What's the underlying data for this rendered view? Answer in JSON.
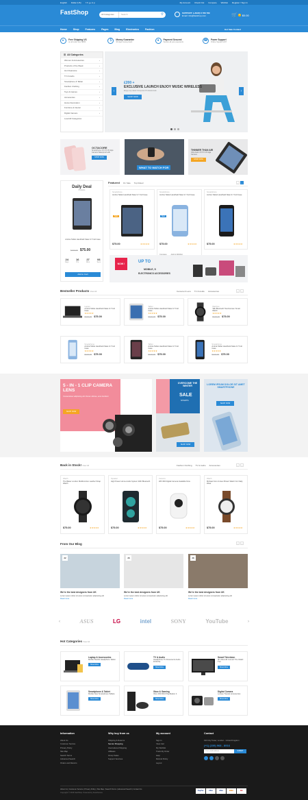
{
  "topbar": {
    "language": "English",
    "currency": "Dollar (US)",
    "links": [
      "My Account",
      "Check Out",
      "Compare",
      "Wishlist",
      "Register / Sign In"
    ]
  },
  "header": {
    "logo": "FastShop",
    "search_category": "All Categories",
    "search_placeholder": "Search",
    "support_title": "SUPPORT: (+8422) 6 789 789",
    "support_email": "Email: info@fastshop.com",
    "cart_count": "0",
    "cart_total": "$0.00"
  },
  "nav": {
    "items": [
      "Home",
      "Shop",
      "Features",
      "Pages",
      "Blog",
      "Electronics",
      "Fashion"
    ],
    "right": "Hot Sale  Contact"
  },
  "features": [
    {
      "title": "Free Shipping US",
      "sub": "on all order over $250"
    },
    {
      "title": "Money Guarantee",
      "sub": "30 days money back"
    },
    {
      "title": "Payment Secured",
      "sub": "Secure all your payments"
    },
    {
      "title": "Power Support",
      "sub": "Online Support 24/7"
    }
  ],
  "categories": {
    "heading": "All Categories",
    "items": [
      "Women & Accessories",
      "Products of the Week",
      "Hot Clearance",
      "TV & Audio",
      "Smartphone & Tablet",
      "Fashion Clothing",
      "Toys & Games",
      "Accessories",
      "Home Decoration",
      "Furniture & Interior",
      "Digital Camera",
      "Load All Categories"
    ]
  },
  "slider": {
    "price": "£200 +",
    "title": "EXCLUSIVE LAUNCH ENJOY MUSIC WIRELESS",
    "sub": "Enjoy top-rated Computer Professionals",
    "button": "SHOP NOW"
  },
  "banners": [
    {
      "title": "OCTACORE",
      "sub": "Smartphone 4.5 3.5 16 Giga Camera Waterproof with",
      "button": "SHOP NOW"
    },
    {
      "title": "WHAT TO WATCH FOR",
      "sub": "",
      "button": ""
    },
    {
      "title": "THINNER THAN AIR",
      "sub": "Ultra book 4.5 5.5 16 Giga Camera",
      "button": "SHOP NOW"
    }
  ],
  "daily_deal": {
    "heading": "Daily Deal",
    "sub": "Products",
    "name": "Ambra Tablet Handheld Slate 9.7 Full Case",
    "old_price": "$100.00",
    "price": "$75.00",
    "timer": [
      {
        "v": "24",
        "l": "Days"
      },
      {
        "v": "16",
        "l": "Hrs"
      },
      {
        "v": "27",
        "l": "Mins"
      },
      {
        "v": "06",
        "l": "Secs"
      }
    ],
    "button": "Add to Cart"
  },
  "featured": {
    "tabs": [
      "Featured",
      "On Sale",
      "Top Rated"
    ],
    "products": [
      {
        "cat": "Smartphone",
        "name": "Ambra Tablet Handheld Slate 9.7 Full Case",
        "price": "$75.00",
        "badge": "Sale"
      },
      {
        "cat": "Smartphone",
        "name": "Ambra Tablet Handheld Slate 9.7 Full Case",
        "price": "$75.00",
        "badge": "New"
      },
      {
        "cat": "Smartphone",
        "name": "Ambra Tablet Handheld Slate 9.7 Full Case",
        "price": "$75.00",
        "badge": ""
      }
    ],
    "actions": [
      "Compare",
      "Add to Wishlist",
      "Add to Cart"
    ]
  },
  "promo_wide": {
    "tag": "NOW !",
    "title": "UP TO",
    "line2": "MOBILE, S",
    "line3": "ELECTRONICS ACCESSORIES"
  },
  "bestseller": {
    "heading": "Bestseller Products",
    "view_all": "View All",
    "tabs": [
      "Camera & Lens",
      "TV & Audio",
      "Accessories"
    ],
    "products": [
      {
        "cat": "Laptop",
        "name": "Ambra Tablet Handheld Slate 9.7 Full Case",
        "old": "$100.00",
        "price": "$75.00"
      },
      {
        "cat": "Tablet",
        "name": "Ambra Tablet Handheld Slate 9.7 Full Case",
        "old": "$100.00",
        "price": "$75.00"
      },
      {
        "cat": "Watches",
        "name": "Talk Bluetooth Touchscreen Smart Watch",
        "old": "$100.00",
        "price": "$75.00"
      },
      {
        "cat": "Smartphone",
        "name": "Ambra Tablet Handheld Slate 9.7 Full Case",
        "old": "$100.00",
        "price": "$75.00"
      },
      {
        "cat": "Tablet",
        "name": "Ambra Tablet Handheld Slate 9.7 Full Case",
        "old": "$100.00",
        "price": "$75.00"
      },
      {
        "cat": "Smartphone",
        "name": "Ambra Tablet Handheld Slate 9.7 Full Case",
        "old": "$100.00",
        "price": "$75.00"
      }
    ]
  },
  "promos2": {
    "clip_title": "5 - IN - 1 CLIP CAMERA LENS",
    "clip_sub": "Consectetuer adipiscing elit. Donec ultrices, eros tincidunt",
    "clip_button": "SHOP NOW",
    "winter_title": "OVERCOME THE WINTER",
    "winter_sale": "SALE",
    "winter_sub": "STARTS",
    "winter_btn": "SHOP NOW",
    "lorem_title": "LOREM IPSUM DOLOR SIT AMET SMARTPHONE",
    "lorem_btn": "SHOP NOW"
  },
  "backinstock": {
    "heading": "Back in Stock!",
    "view_all": "View All",
    "tabs": [
      "Fashion Clothing",
      "TV & Audio",
      "Accessories"
    ],
    "products": [
      {
        "cat": "Watch",
        "name": "The Baker London Multifunction Leather Strap Watch",
        "price": "$75.00"
      },
      {
        "cat": "Speaker",
        "name": "High Power Home Audio System With Bluetooth",
        "price": "$75.00"
      },
      {
        "cat": "Camera",
        "name": "Wifi 360 Digital Camera Available Now",
        "price": "$75.00"
      },
      {
        "cat": "Watch",
        "name": "Michael Kors Unisex Brown Watch For Daily Wear",
        "price": "$75.00"
      }
    ]
  },
  "blog": {
    "heading": "From Our Blog",
    "posts": [
      {
        "day": "22",
        "title": "We're the best designers from UK",
        "excerpt": "Lorem ipsum dolor sit amet consectetur adipiscing elit",
        "more": "Read more"
      },
      {
        "day": "26",
        "title": "We're the best designers from UK",
        "excerpt": "Lorem ipsum dolor sit amet consectetur adipiscing elit",
        "more": "Read more"
      },
      {
        "day": "28",
        "title": "We're the best designers from UK",
        "excerpt": "Lorem ipsum dolor sit amet consectetur adipiscing elit",
        "more": "Read more"
      }
    ]
  },
  "brands": [
    "ASUS",
    "LG",
    "intel",
    "SONY",
    "YouTube"
  ],
  "hot_categories": {
    "heading": "Hot Categories",
    "view_all": "View All",
    "items": [
      {
        "title": "Laptop & Accessories",
        "list": "Mobile Stands  Headphone Tablet",
        "btn": "Show More"
      },
      {
        "title": "TV & Audio",
        "list": "Headphone  TV Personal & Audio DVD Pla",
        "btn": "Show More"
      },
      {
        "title": "Smart Television",
        "list": "4K Ultra HD  Curved TVs  OLED TVs",
        "btn": "Show More"
      },
      {
        "title": "Smartphone & Tablet",
        "list": "Mobile  New Smartphone  Tablets",
        "btn": "Show More"
      },
      {
        "title": "Xbox & Gaming",
        "list": "Xbox 360  WiiU  PlayStation 4",
        "btn": "Show More"
      },
      {
        "title": "Digital Camera",
        "list": "Lenses  Tripods  Accessories",
        "btn": "Show More"
      }
    ]
  },
  "footer": {
    "cols": [
      {
        "title": "Information",
        "items": [
          "About Us",
          "Customer Service",
          "Privacy Policy",
          "Site Map",
          "Search Terms",
          "Advanced Search",
          "Orders and Returns"
        ]
      },
      {
        "title": "Why buy from us",
        "items": [
          "Shipping & Returns",
          "Secure Shopping",
          "International Shipping",
          "Affiliates",
          "Group Sales",
          "Support Services"
        ]
      },
      {
        "title": "My account",
        "items": [
          "Sign In",
          "View Cart",
          "My Wishlist",
          "Track My Order",
          "Help",
          "Refund Policy",
          "Layout"
        ]
      }
    ],
    "contact_title": "Contact",
    "address": "193 City Tower, London - United Kingdom",
    "phone": "(+1) (239) 968 - 8916",
    "email_placeholder": "Your email address",
    "subscribe": "SUBMIT",
    "bottom_links": "About Us  |  Customer Service  |  Privacy Policy  |  Site Map  |  Search Terms  |  Advanced Search  |  Contact Us",
    "copyright": "Copyright © 2016 FastShop. Powered by Kutethemes",
    "payments": [
      "PayPal",
      "VISA",
      "VISA",
      "DISC",
      "MC"
    ]
  }
}
